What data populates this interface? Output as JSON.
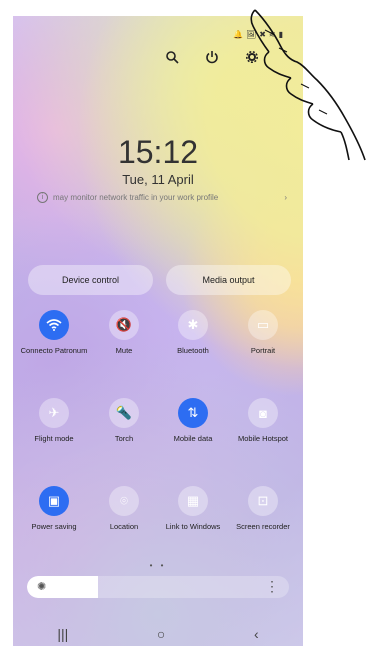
{
  "status_icons": [
    "bell-icon",
    "gallery-icon",
    "mute-icon",
    "wifi-icon",
    "signal-icon"
  ],
  "quick_icons": {
    "search": "search-icon",
    "power": "power-icon",
    "settings": "gear-icon"
  },
  "clock": {
    "time": "15:12",
    "date": "Tue, 11 April"
  },
  "notice": {
    "text": "may monitor network traffic in your work profile",
    "arrow": "›"
  },
  "pills": {
    "device_control": "Device control",
    "media_output": "Media output"
  },
  "tiles": [
    {
      "label": "Connecto Patronum",
      "icon": "wifi-icon",
      "active": true
    },
    {
      "label": "Mute",
      "icon": "mute-icon",
      "active": false
    },
    {
      "label": "Bluetooth",
      "icon": "bluetooth-icon",
      "active": false
    },
    {
      "label": "Portrait",
      "icon": "portrait-icon",
      "active": false
    },
    {
      "label": "Flight mode",
      "icon": "airplane-icon",
      "active": false
    },
    {
      "label": "Torch",
      "icon": "torch-icon",
      "active": false
    },
    {
      "label": "Mobile data",
      "icon": "mobile-data-icon",
      "active": true
    },
    {
      "label": "Mobile Hotspot",
      "icon": "hotspot-icon",
      "active": false
    },
    {
      "label": "Power saving",
      "icon": "battery-icon",
      "active": true
    },
    {
      "label": "Location",
      "icon": "location-icon",
      "active": false
    },
    {
      "label": "Link to Windows",
      "icon": "link-windows-icon",
      "active": false
    },
    {
      "label": "Screen recorder",
      "icon": "screen-recorder-icon",
      "active": false
    }
  ],
  "page_dots": "• •",
  "brightness": {
    "level": 0.27
  },
  "nav": {
    "recents": "|||",
    "home": "○",
    "back": "‹"
  },
  "colors": {
    "accent": "#2d6df2"
  }
}
